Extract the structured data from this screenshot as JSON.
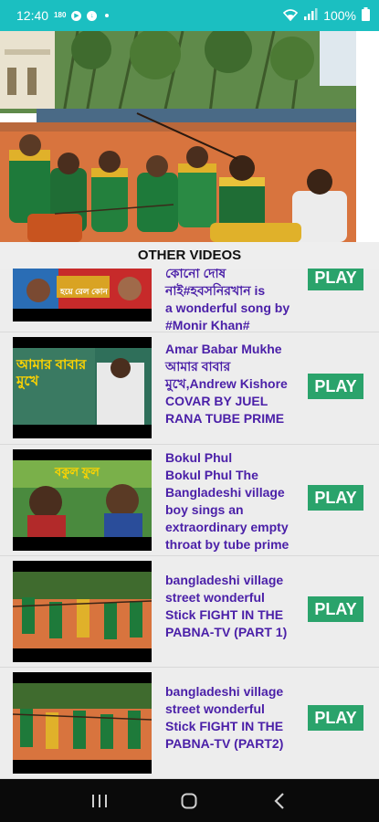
{
  "status_bar": {
    "time": "12:40",
    "indicator": "180",
    "battery_text": "100%",
    "icons": [
      "notification-badge-icon",
      "play-circle-icon",
      "download-circle-icon",
      "dot-icon",
      "wifi-icon",
      "signal-icon",
      "battery-icon"
    ]
  },
  "hero": {
    "icon": "stick-fight-scene-image"
  },
  "section": {
    "title": "OTHER VIDEOS"
  },
  "videos": [
    {
      "title": "কোনো দোষ\nনাই#হবসনিরখান is\na wonderful song by\n#Monir Khan#",
      "play_label": "PLAY",
      "thumb_text": "হয়ে রেল কোন"
    },
    {
      "title": "Amar Babar Mukhe\nআমার বাবার\nমুখে,Andrew Kishore\nCOVAR BY JUEL\nRANA TUBE PRIME",
      "play_label": "PLAY",
      "thumb_text": "আমার বাবার মুখে"
    },
    {
      "title": "Bokul Phul\nBokul Phul The\nBangladeshi village\nboy sings an\nextraordinary empty\nthroat by tube prime",
      "play_label": "PLAY",
      "thumb_text": "বকুল ফুল"
    },
    {
      "title": "bangladeshi village\nstreet  wonderful\nStick FIGHT IN THE\nPABNA-TV (PART 1)",
      "play_label": "PLAY"
    },
    {
      "title": "bangladeshi village\nstreet  wonderful\nStick FIGHT IN THE\nPABNA-TV (PART2)",
      "play_label": "PLAY"
    }
  ],
  "nav_bar": {
    "icons": [
      "recent-apps-icon",
      "home-icon",
      "back-icon"
    ]
  },
  "colors": {
    "status_bar": "#1bbfc1",
    "title_text": "#4a1fa8",
    "play_button": "#2aa36b",
    "list_bg": "#ededed"
  }
}
